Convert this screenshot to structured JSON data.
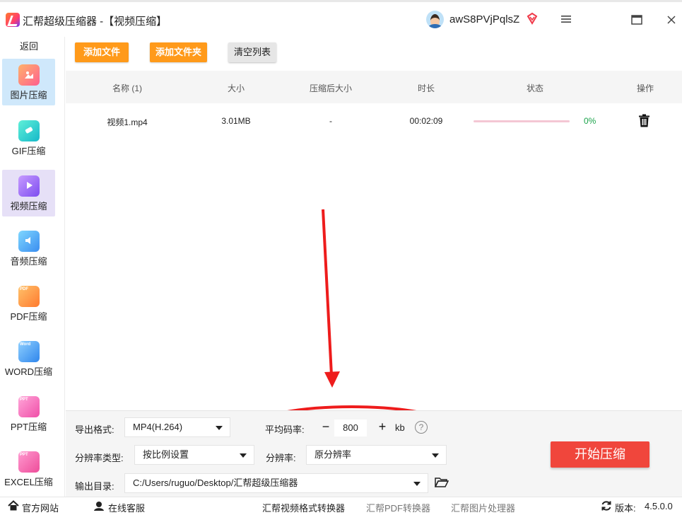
{
  "window": {
    "title": "汇帮超级压缩器  -【视频压缩】",
    "username": "awS8PVjPqlsZ",
    "accent": "#ff9a1a",
    "danger": "#f0463c"
  },
  "sidebar": {
    "back_label": "返回",
    "items": [
      {
        "label": "图片压缩",
        "icon": "image-icon"
      },
      {
        "label": "GIF压缩",
        "icon": "gif-icon"
      },
      {
        "label": "视频压缩",
        "icon": "video-icon"
      },
      {
        "label": "音频压缩",
        "icon": "audio-icon"
      },
      {
        "label": "PDF压缩",
        "icon": "pdf-icon",
        "badge": "PDF"
      },
      {
        "label": "WORD压缩",
        "icon": "word-icon",
        "badge": "Word"
      },
      {
        "label": "PPT压缩",
        "icon": "ppt-icon",
        "badge": "PPT"
      },
      {
        "label": "EXCEL压缩",
        "icon": "excel-icon",
        "badge": "PPT"
      }
    ]
  },
  "toolbar": {
    "add_file": "添加文件",
    "add_folder": "添加文件夹",
    "clear_list": "清空列表"
  },
  "table": {
    "columns": [
      "名称 (1)",
      "大小",
      "压缩后大小",
      "时长",
      "状态",
      "操作"
    ],
    "rows": [
      {
        "name": "视频1.mp4",
        "size": "3.01MB",
        "compressed": "-",
        "duration": "00:02:09",
        "progress": 0,
        "progress_text": "0%"
      }
    ]
  },
  "settings": {
    "format_label": "导出格式:",
    "format_value": "MP4(H.264)",
    "bitrate_label": "平均码率:",
    "bitrate_minus": "−",
    "bitrate_value": "800",
    "bitrate_plus": "+",
    "bitrate_unit": "kb",
    "help": "?",
    "res_type_label": "分辨率类型:",
    "res_type_value": "按比例设置",
    "res_label": "分辨率:",
    "res_value": "原分辨率",
    "output_label": "输出目录:",
    "output_value": "C:/Users/ruguo/Desktop/汇帮超级压缩器",
    "start_button": "开始压缩"
  },
  "footer": {
    "website": "官方网站",
    "support": "在线客服",
    "video_converter": "汇帮视频格式转换器",
    "pdf_converter": "汇帮PDF转换器",
    "image_processor": "汇帮图片处理器",
    "version_label": "版本:",
    "version": "4.5.0.0"
  }
}
